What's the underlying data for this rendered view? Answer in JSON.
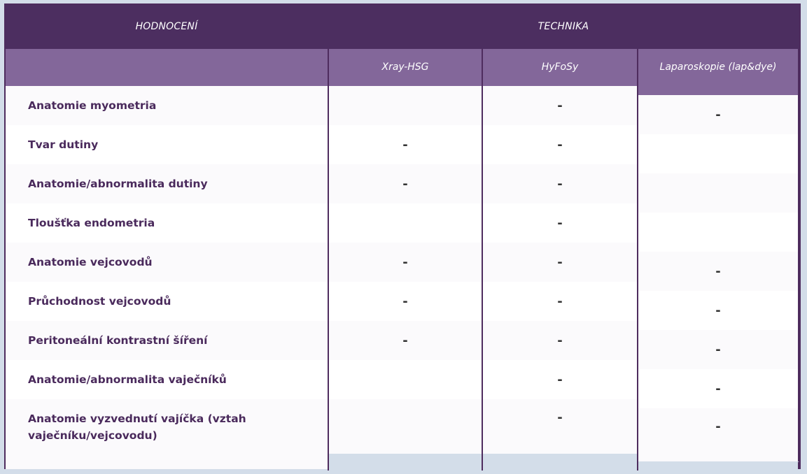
{
  "header": {
    "left_title": "HODNOCENÍ",
    "right_title": "TECHNIKA"
  },
  "columns": [
    {
      "label": "Xray-HSG"
    },
    {
      "label": "HyFoSy"
    },
    {
      "label": "Laparoskopie (lap&dye)"
    }
  ],
  "rows": [
    {
      "label": "Anatomie myometria",
      "xray": "",
      "hyfosy": "-",
      "lap": "-"
    },
    {
      "label": "Tvar dutiny",
      "xray": "-",
      "hyfosy": "-",
      "lap": ""
    },
    {
      "label": "Anatomie/abnormalita dutiny",
      "xray": "-",
      "hyfosy": "-",
      "lap": ""
    },
    {
      "label": "Tloušťka endometria",
      "xray": "",
      "hyfosy": "-",
      "lap": ""
    },
    {
      "label": "Anatomie vejcovodů",
      "xray": "-",
      "hyfosy": "-",
      "lap": "-"
    },
    {
      "label": "Průchodnost vejcovodů",
      "xray": "-",
      "hyfosy": "-",
      "lap": "-"
    },
    {
      "label": "Peritoneální kontrastní šíření",
      "xray": "-",
      "hyfosy": "-",
      "lap": "-"
    },
    {
      "label": "Anatomie/abnormalita vaječníků",
      "xray": "",
      "hyfosy": "-",
      "lap": "-"
    },
    {
      "label": "Anatomie vyzvednutí vajíčka (vztah vaječníku/vejcovodu)",
      "xray": "",
      "hyfosy": "-",
      "lap": "-"
    }
  ]
}
